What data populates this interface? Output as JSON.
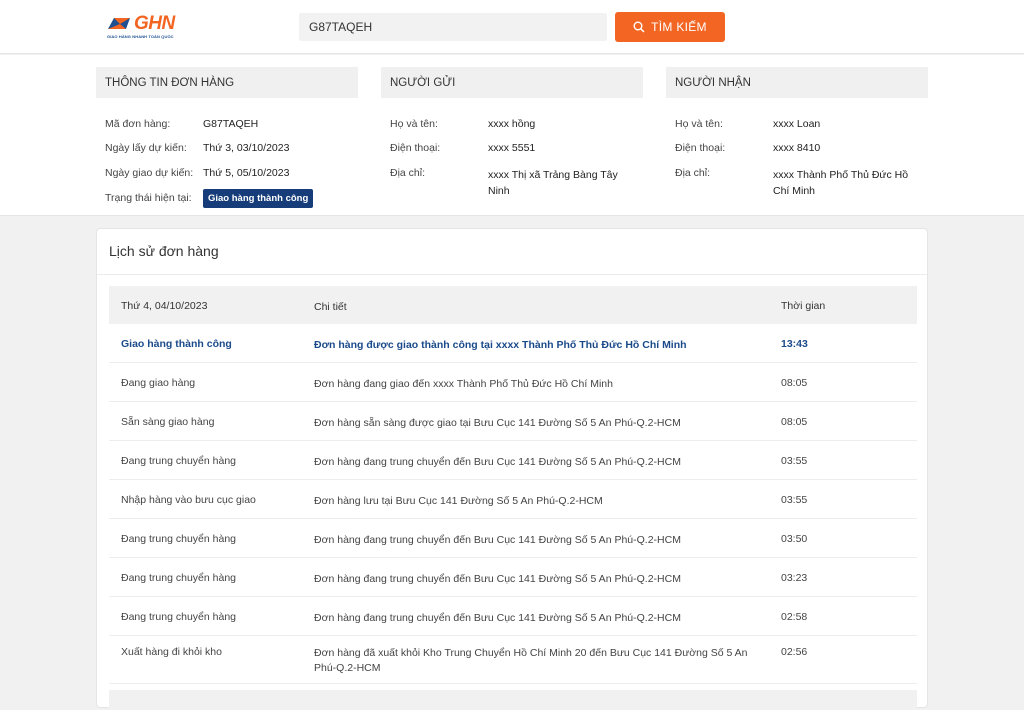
{
  "header": {
    "logo_text": "GHN",
    "logo_tagline": "GIAO HÀNG NHANH TOÀN QUỐC",
    "search_value": "G87TAQEH",
    "search_button": "TÌM KIẾM",
    "colors": {
      "accent": "#f26522",
      "brand_blue": "#163d7a"
    }
  },
  "order_info": {
    "title": "THÔNG TIN ĐƠN HÀNG",
    "code_label": "Mã đơn hàng:",
    "code_value": "G87TAQEH",
    "pickup_label": "Ngày lấy dự kiến:",
    "pickup_value": "Thứ 3, 03/10/2023",
    "delivery_label": "Ngày giao dự kiến:",
    "delivery_value": "Thứ 5, 05/10/2023",
    "status_label": "Trạng thái hiện tại:",
    "status_value": "Giao hàng thành công"
  },
  "sender": {
    "title": "NGƯỜI GỬI",
    "name_label": "Họ và tên:",
    "name_value": "xxxx hồng",
    "phone_label": "Điện thoại:",
    "phone_value": "xxxx 5551",
    "address_label": "Địa chỉ:",
    "address_value": "xxxx Thị xã Trảng Bàng Tây Ninh"
  },
  "receiver": {
    "title": "NGƯỜI NHẬN",
    "name_label": "Họ và tên:",
    "name_value": "xxxx Loan",
    "phone_label": "Điện thoại:",
    "phone_value": "xxxx 8410",
    "address_label": "Địa chỉ:",
    "address_value": "xxxx Thành Phố Thủ Đức Hồ Chí Minh"
  },
  "history": {
    "title": "Lịch sử đơn hàng",
    "columns": [
      "Thứ 4, 04/10/2023",
      "Chi tiết",
      "Thời gian"
    ],
    "rows": [
      {
        "status": "Giao hàng thành công",
        "detail": "Đơn hàng được giao thành công tại xxxx Thành Phố Thủ Đức Hồ Chí Minh",
        "time": "13:43"
      },
      {
        "status": "Đang giao hàng",
        "detail": "Đơn hàng đang giao đến xxxx Thành Phố Thủ Đức Hồ Chí Minh",
        "time": "08:05"
      },
      {
        "status": "Sẵn sàng giao hàng",
        "detail": "Đơn hàng sẵn sàng được giao tại Bưu Cục 141 Đường Số 5 An Phú-Q.2-HCM",
        "time": "08:05"
      },
      {
        "status": "Đang trung chuyển hàng",
        "detail": "Đơn hàng đang trung chuyển đến Bưu Cục 141 Đường Số 5 An Phú-Q.2-HCM",
        "time": "03:55"
      },
      {
        "status": "Nhập hàng vào bưu cục giao",
        "detail": "Đơn hàng lưu tại Bưu Cục 141 Đường Số 5 An Phú-Q.2-HCM",
        "time": "03:55"
      },
      {
        "status": "Đang trung chuyển hàng",
        "detail": "Đơn hàng đang trung chuyển đến Bưu Cục 141 Đường Số 5 An Phú-Q.2-HCM",
        "time": "03:50"
      },
      {
        "status": "Đang trung chuyển hàng",
        "detail": "Đơn hàng đang trung chuyển đến Bưu Cục 141 Đường Số 5 An Phú-Q.2-HCM",
        "time": "03:23"
      },
      {
        "status": "Đang trung chuyển hàng",
        "detail": "Đơn hàng đang trung chuyển đến Bưu Cục 141 Đường Số 5 An Phú-Q.2-HCM",
        "time": "02:58"
      },
      {
        "status": "Xuất hàng đi khỏi kho",
        "detail": "Đơn hàng đã xuất khỏi Kho Trung Chuyển Hồ Chí Minh 20 đến Bưu Cục 141 Đường Số 5 An Phú-Q.2-HCM",
        "time": "02:56"
      }
    ]
  }
}
